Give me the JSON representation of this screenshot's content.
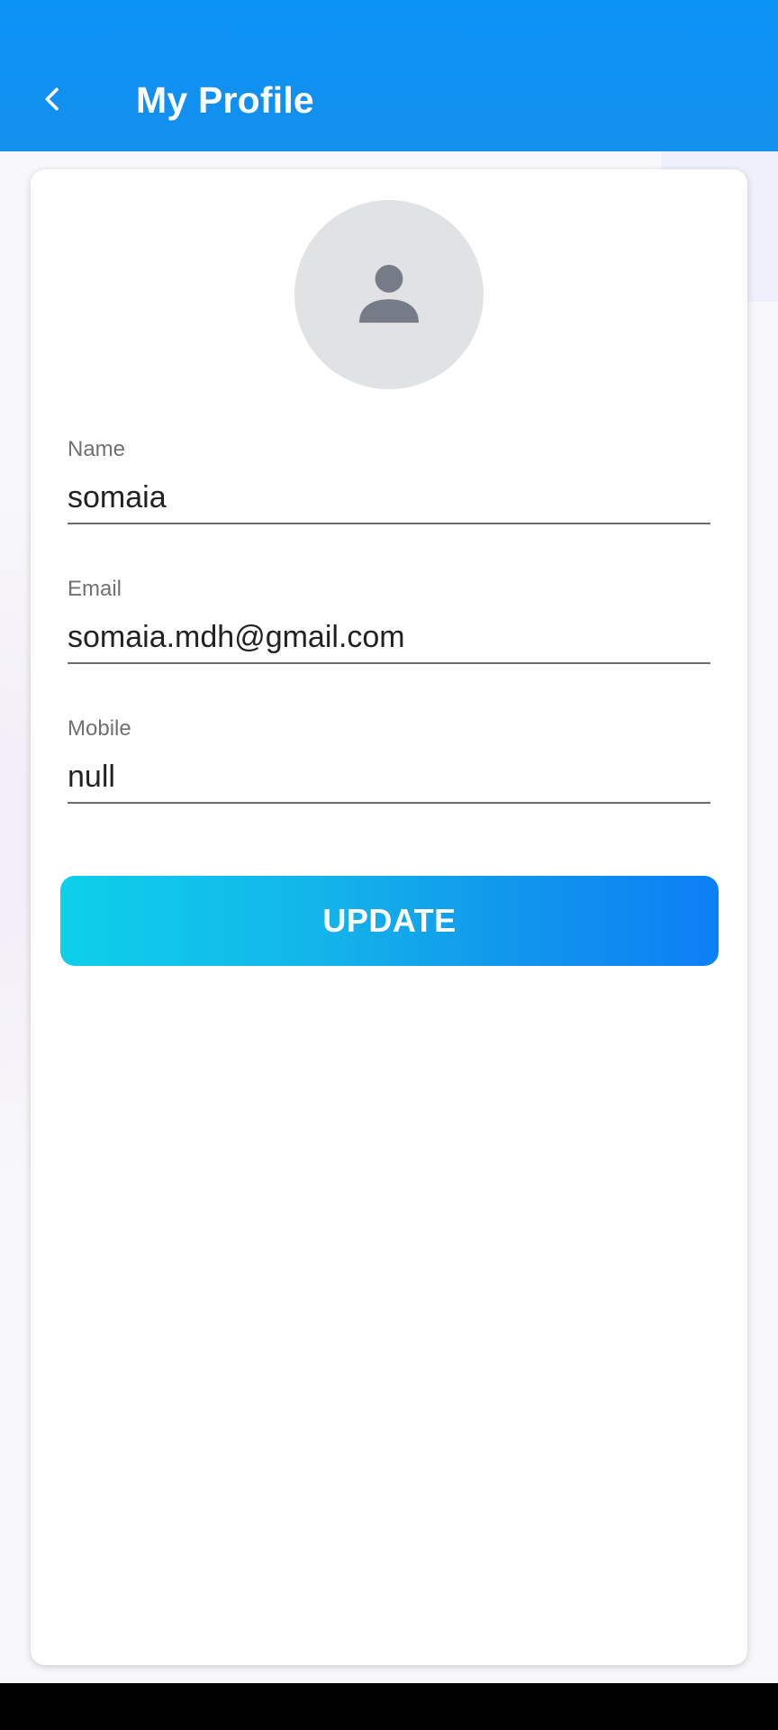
{
  "header": {
    "title": "My Profile",
    "back_icon": "chevron-left-icon"
  },
  "profile": {
    "avatar_icon": "person-icon",
    "fields": [
      {
        "label": "Name",
        "value": "somaia"
      },
      {
        "label": "Email",
        "value": "somaia.mdh@gmail.com"
      },
      {
        "label": "Mobile",
        "value": "null"
      }
    ],
    "update_label": "UPDATE"
  },
  "colors": {
    "app_bar": "#0b92f5",
    "button_gradient_start": "#0dd0ea",
    "button_gradient_end": "#0c7ff6",
    "avatar_bg": "#e1e2e4",
    "avatar_icon": "#757c87"
  }
}
